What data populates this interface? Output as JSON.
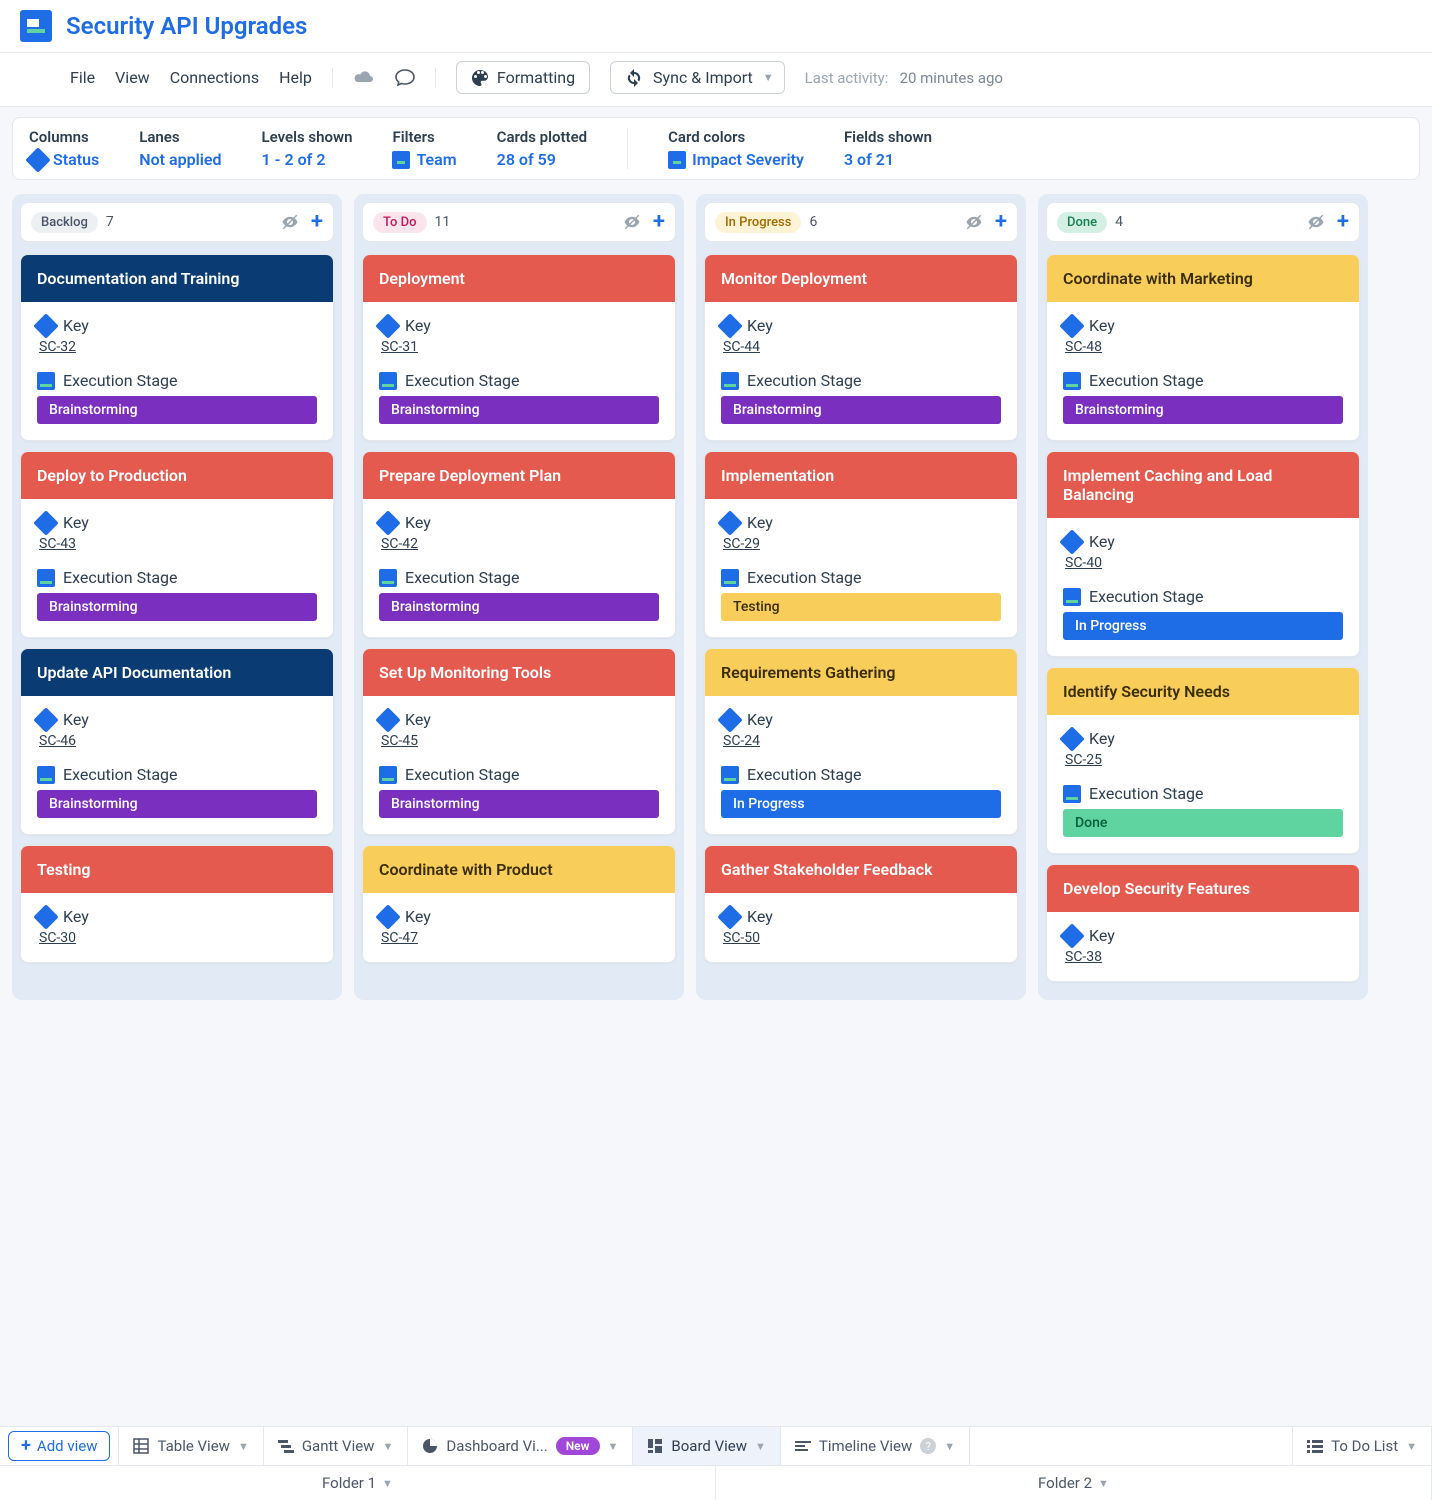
{
  "header": {
    "title": "Security API Upgrades"
  },
  "menu": {
    "file": "File",
    "view": "View",
    "connections": "Connections",
    "help": "Help",
    "formatting": "Formatting",
    "sync_import": "Sync & Import",
    "last_activity_label": "Last activity:",
    "last_activity_value": "20 minutes ago"
  },
  "filters": {
    "columns": {
      "label": "Columns",
      "value": "Status"
    },
    "lanes": {
      "label": "Lanes",
      "value": "Not applied"
    },
    "levels": {
      "label": "Levels shown",
      "value": "1 - 2 of 2"
    },
    "filter": {
      "label": "Filters",
      "value": "Team"
    },
    "cards": {
      "label": "Cards plotted",
      "value": "28 of 59"
    },
    "colors": {
      "label": "Card colors",
      "value": "Impact Severity"
    },
    "fields": {
      "label": "Fields shown",
      "value": "3 of 21"
    }
  },
  "field_labels": {
    "key": "Key",
    "stage": "Execution Stage"
  },
  "columns": [
    {
      "name": "Backlog",
      "count": "7",
      "pill": "pill-backlog",
      "cards": [
        {
          "title": "Documentation and Training",
          "hdr": "hdr-navy",
          "key": "SC-32",
          "stage": "Brainstorming",
          "sp": "sp-brainstorm"
        },
        {
          "title": "Deploy to Production",
          "hdr": "hdr-red",
          "key": "SC-43",
          "stage": "Brainstorming",
          "sp": "sp-brainstorm"
        },
        {
          "title": "Update API Documentation",
          "hdr": "hdr-navy",
          "key": "SC-46",
          "stage": "Brainstorming",
          "sp": "sp-brainstorm"
        },
        {
          "title": "Testing",
          "hdr": "hdr-red",
          "key": "SC-30",
          "stage": "",
          "sp": ""
        }
      ]
    },
    {
      "name": "To Do",
      "count": "11",
      "pill": "pill-todo",
      "cards": [
        {
          "title": "Deployment",
          "hdr": "hdr-red",
          "key": "SC-31",
          "stage": "Brainstorming",
          "sp": "sp-brainstorm"
        },
        {
          "title": "Prepare Deployment Plan",
          "hdr": "hdr-red",
          "key": "SC-42",
          "stage": "Brainstorming",
          "sp": "sp-brainstorm"
        },
        {
          "title": "Set Up Monitoring Tools",
          "hdr": "hdr-red",
          "key": "SC-45",
          "stage": "Brainstorming",
          "sp": "sp-brainstorm"
        },
        {
          "title": "Coordinate with Product",
          "hdr": "hdr-yellow",
          "key": "SC-47",
          "stage": "",
          "sp": ""
        }
      ]
    },
    {
      "name": "In Progress",
      "count": "6",
      "pill": "pill-inprogress",
      "cards": [
        {
          "title": "Monitor Deployment",
          "hdr": "hdr-red",
          "key": "SC-44",
          "stage": "Brainstorming",
          "sp": "sp-brainstorm"
        },
        {
          "title": "Implementation",
          "hdr": "hdr-red",
          "key": "SC-29",
          "stage": "Testing",
          "sp": "sp-testing"
        },
        {
          "title": "Requirements Gathering",
          "hdr": "hdr-yellow",
          "key": "SC-24",
          "stage": "In Progress",
          "sp": "sp-inprogress"
        },
        {
          "title": "Gather Stakeholder Feedback",
          "hdr": "hdr-red",
          "key": "SC-50",
          "stage": "",
          "sp": ""
        }
      ]
    },
    {
      "name": "Done",
      "count": "4",
      "pill": "pill-done",
      "cards": [
        {
          "title": "Coordinate with Marketing",
          "hdr": "hdr-yellow",
          "key": "SC-48",
          "stage": "Brainstorming",
          "sp": "sp-brainstorm"
        },
        {
          "title": "Implement Caching and Load Balancing",
          "hdr": "hdr-red",
          "key": "SC-40",
          "stage": "In Progress",
          "sp": "sp-inprogress"
        },
        {
          "title": "Identify Security Needs",
          "hdr": "hdr-yellow",
          "key": "SC-25",
          "stage": "Done",
          "sp": "sp-done"
        },
        {
          "title": "Develop Security Features",
          "hdr": "hdr-red",
          "key": "SC-38",
          "stage": "",
          "sp": ""
        }
      ]
    }
  ],
  "views": {
    "add_view": "Add view",
    "tabs": [
      "Table View",
      "Gantt View",
      "Dashboard Vi...",
      "Board View",
      "Timeline View",
      "To Do List"
    ],
    "new_label": "New",
    "folders": [
      "Folder 1",
      "Folder 2"
    ]
  }
}
